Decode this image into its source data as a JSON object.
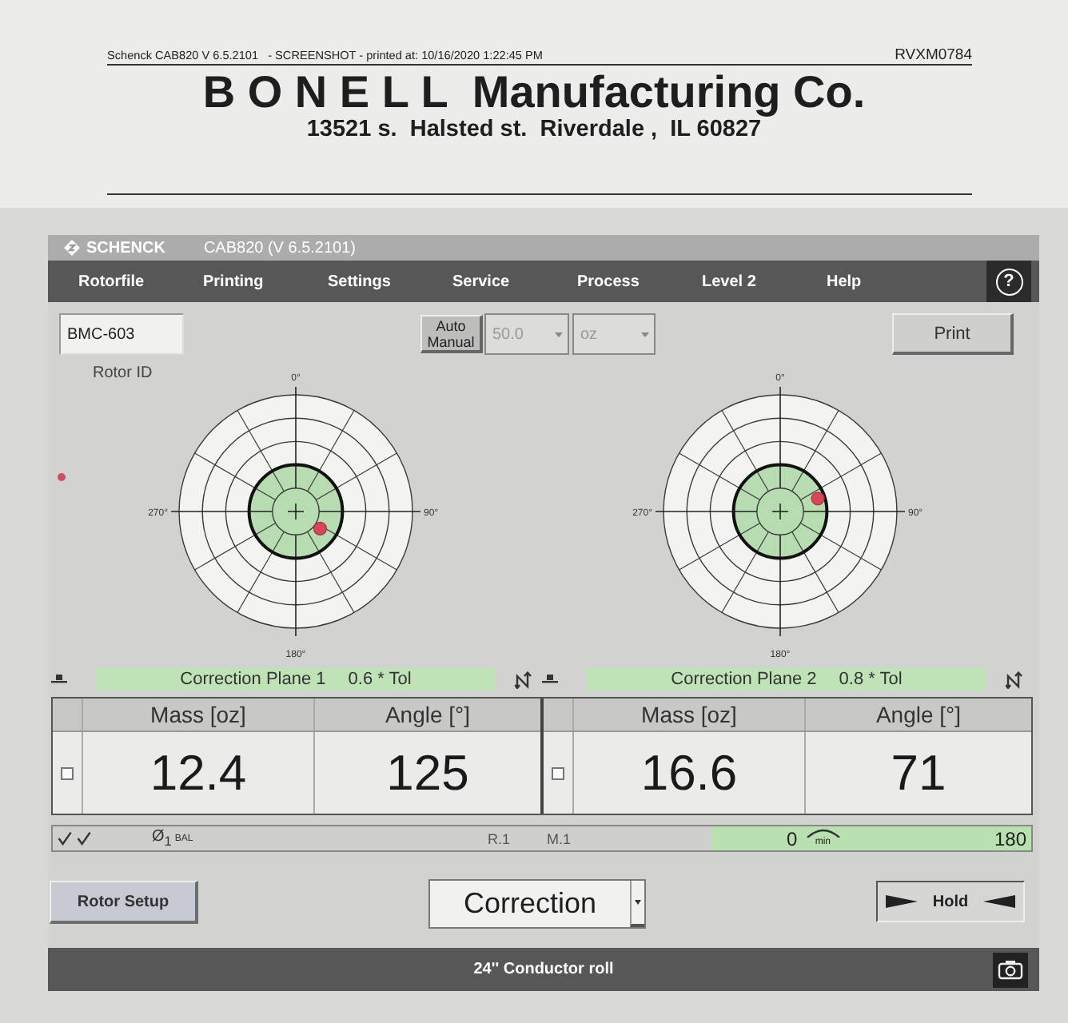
{
  "print_header": {
    "left": "Schenck CAB820 V 6.5.2101   - SCREENSHOT - printed at: 10/16/2020 1:22:45 PM",
    "right": "RVXM0784"
  },
  "letterhead": {
    "company": "B O N E L L  Manufacturing Co.",
    "address": "13521 s.  Halsted st.  Riverdale ,  IL 60827"
  },
  "window": {
    "brand": "SCHENCK",
    "title": "CAB820 (V 6.5.2101)"
  },
  "menu": [
    "Rotorfile",
    "Printing",
    "Settings",
    "Service",
    "Process",
    "Level 2",
    "Help"
  ],
  "help_button": "?",
  "toolbar": {
    "rotor_id": {
      "value": "BMC-603",
      "label": "Rotor ID"
    },
    "mode_button": [
      "Auto",
      "Manual"
    ],
    "amount": {
      "value": "50.0",
      "disabled": true
    },
    "unit": {
      "value": "oz",
      "disabled": true
    },
    "print_button": "Print"
  },
  "plots": [
    {
      "labels": [
        "0°",
        "90°",
        "180°",
        "270°"
      ]
    },
    {
      "labels": [
        "0°",
        "90°",
        "180°",
        "270°"
      ]
    }
  ],
  "planes": [
    {
      "title": "Correction Plane 1",
      "tolerance": "0.6 * Tol",
      "columns": [
        "Mass [oz]",
        "Angle [°]"
      ],
      "mass": "12.4",
      "angle": "125",
      "checked": false
    },
    {
      "title": "Correction Plane 2",
      "tolerance": "0.8 * Tol",
      "columns": [
        "Mass [oz]",
        "Angle [°]"
      ],
      "mass": "16.6",
      "angle": "71",
      "checked": false
    }
  ],
  "status_bar": {
    "balance_symbol": "Ø$_{1}$",
    "balance_label": "BAL",
    "run": "R.1",
    "mode": "M.1",
    "speed": {
      "from": "0",
      "unit": "min",
      "to": "180"
    }
  },
  "bottom": {
    "rotor_setup_button": "Rotor Setup",
    "mode_select": "Correction",
    "hold_button": "Hold"
  },
  "footer": {
    "title": "24'' Conductor roll"
  }
}
